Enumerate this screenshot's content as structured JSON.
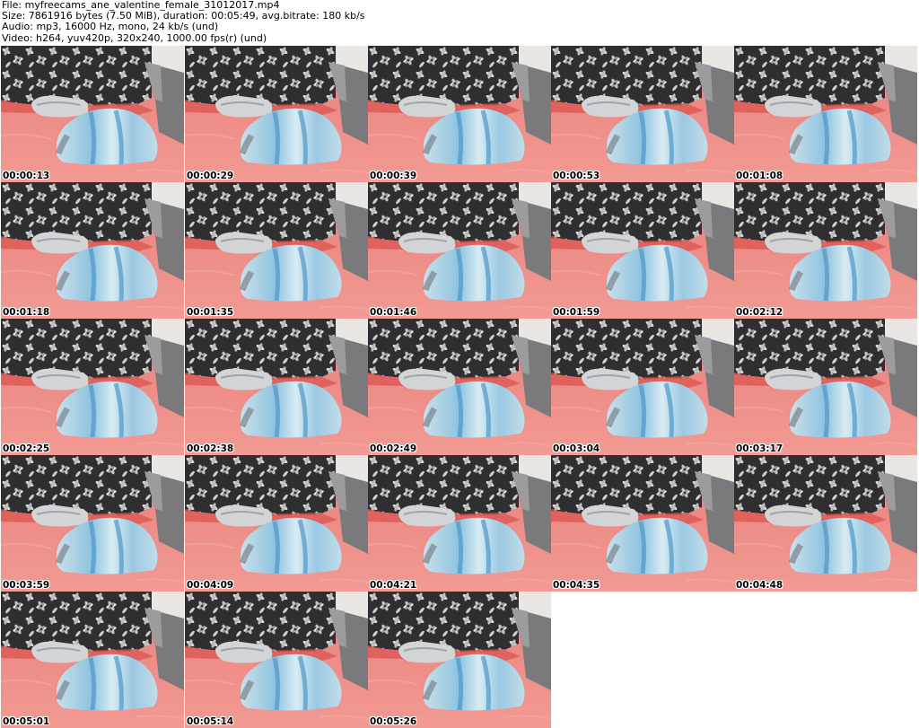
{
  "header": {
    "file_line": "File: myfreecams_ane_valentine_female_31012017.mp4",
    "size_line": "Size: 7861916 bytes (7.50 MiB), duration: 00:05:49, avg.bitrate: 180 kb/s",
    "audio_line": "Audio: mp3, 16000 Hz, mono, 24 kb/s (und)",
    "video_line": "Video: h264, yuv420p, 320x240, 1000.00 fps(r) (und)"
  },
  "thumbnails": [
    {
      "timestamp": "00:00:13"
    },
    {
      "timestamp": "00:00:29"
    },
    {
      "timestamp": "00:00:39"
    },
    {
      "timestamp": "00:00:53"
    },
    {
      "timestamp": "00:01:08"
    },
    {
      "timestamp": "00:01:18"
    },
    {
      "timestamp": "00:01:35"
    },
    {
      "timestamp": "00:01:46"
    },
    {
      "timestamp": "00:01:59"
    },
    {
      "timestamp": "00:02:12"
    },
    {
      "timestamp": "00:02:25"
    },
    {
      "timestamp": "00:02:38"
    },
    {
      "timestamp": "00:02:49"
    },
    {
      "timestamp": "00:03:04"
    },
    {
      "timestamp": "00:03:17"
    },
    {
      "timestamp": "00:03:59"
    },
    {
      "timestamp": "00:04:09"
    },
    {
      "timestamp": "00:04:21"
    },
    {
      "timestamp": "00:04:35"
    },
    {
      "timestamp": "00:04:48"
    },
    {
      "timestamp": "00:05:01"
    },
    {
      "timestamp": "00:05:14"
    },
    {
      "timestamp": "00:05:26"
    }
  ],
  "colors": {
    "background": "#ffffff",
    "bed_sheet": "#e47e7c",
    "headboard": "#3a3a3c",
    "pillow_cover": "#a9cde0",
    "pillow_stripe": "#5ba8d6",
    "sofa_arm": "#6f6f6f",
    "timestamp_text": "#000000"
  }
}
